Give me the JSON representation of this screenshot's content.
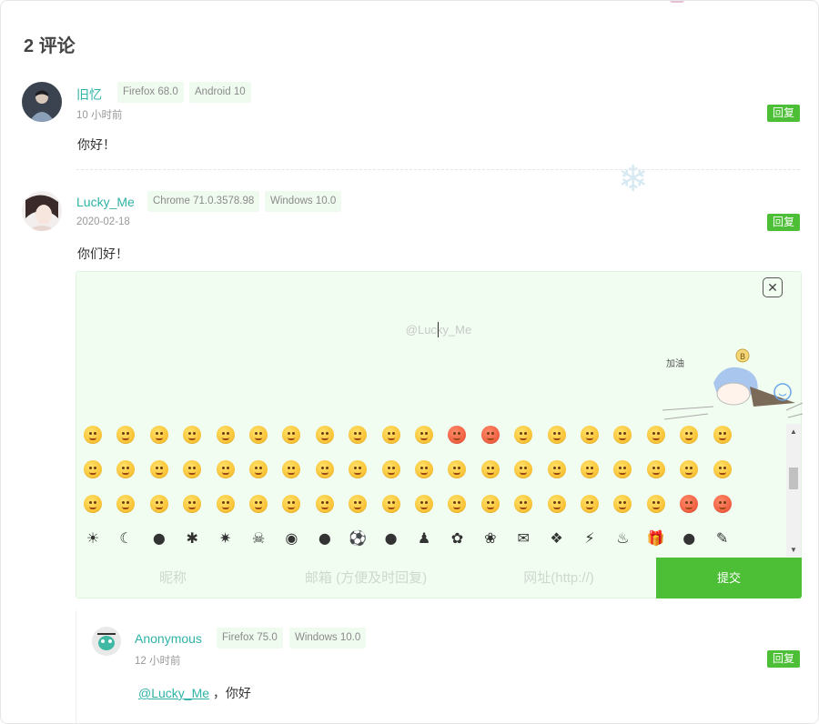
{
  "heading": {
    "count": "2",
    "label": "评论"
  },
  "comments": [
    {
      "author": "旧忆",
      "browser": "Firefox 68.0",
      "os": "Android 10",
      "time": "10 小时前",
      "text": "你好！",
      "reply_label": "回复"
    },
    {
      "author": "Lucky_Me",
      "browser": "Chrome 71.0.3578.98",
      "os": "Windows 10.0",
      "time": "2020-02-18",
      "text": "你们好！",
      "reply_label": "回复"
    }
  ],
  "reply_form": {
    "placeholder": "@Lucky_Me",
    "close_icon": "close-icon",
    "nickname_placeholder": "昵称",
    "email_placeholder": "邮箱 (方便及时回复)",
    "url_placeholder": "网址(http://)",
    "submit_label": "提交",
    "mascot_text": "加油"
  },
  "child_comment": {
    "author": "Anonymous",
    "browser": "Firefox 75.0",
    "os": "Windows 10.0",
    "time": "12 小时前",
    "mention": "@Lucky_Me",
    "text": "，你好",
    "reply_label": "回复"
  },
  "colors": {
    "accent_green": "#4cbf36",
    "author_teal": "#2fb3a6",
    "form_background": "#f0fdf0"
  }
}
